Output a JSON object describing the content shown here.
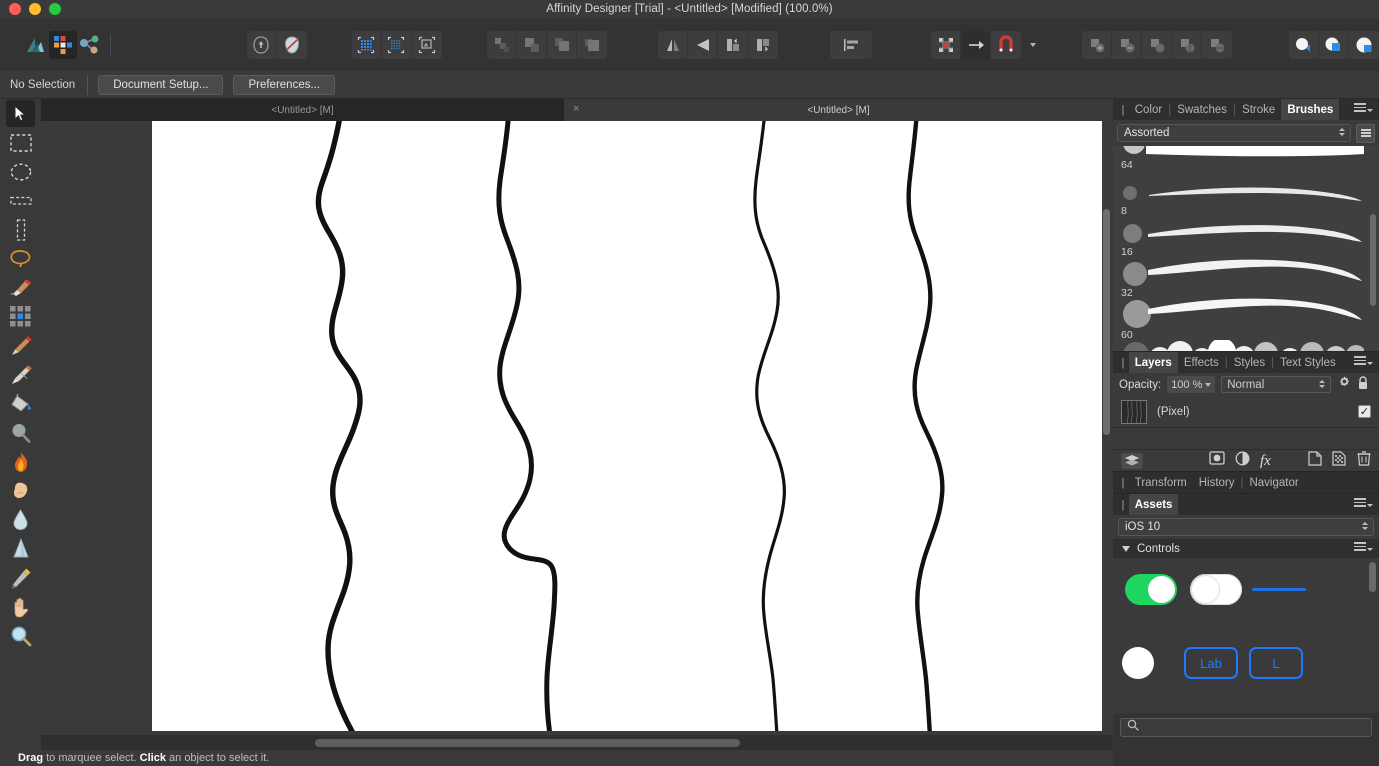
{
  "window": {
    "title": "Affinity Designer [Trial] - <Untitled> [Modified] (100.0%)",
    "traffic_lights": [
      "close",
      "minimize",
      "maximize"
    ]
  },
  "toolbar": {
    "personas": [
      {
        "name": "designer-persona",
        "label": "Designer Persona",
        "active": false
      },
      {
        "name": "pixel-persona",
        "label": "Pixel Persona",
        "active": true
      },
      {
        "name": "export-persona",
        "label": "Export Persona",
        "active": false
      }
    ],
    "groups": [
      {
        "name": "mask-group",
        "buttons": [
          "Add Mask",
          "Clear Mask"
        ]
      },
      {
        "name": "selection-group",
        "buttons": [
          "Refine Selection",
          "Invert Pixel Selection",
          "Selection From Layer"
        ]
      },
      {
        "name": "order-group",
        "buttons": [
          "Move to Front",
          "Move Forward",
          "Move Backward",
          "Move to Back"
        ]
      },
      {
        "name": "flip-group",
        "buttons": [
          "Flip Horizontal",
          "Flip Vertical",
          "Rotate Left",
          "Rotate Right"
        ]
      },
      {
        "name": "align-group",
        "buttons": [
          "Alignment"
        ]
      },
      {
        "name": "snap-group",
        "buttons": [
          "Show Grid",
          "Snapping",
          "Snapping Options"
        ]
      },
      {
        "name": "boolean-group",
        "buttons": [
          "Add",
          "Subtract",
          "Intersect",
          "Divide",
          "Combine"
        ]
      },
      {
        "name": "blend-group",
        "buttons": [
          "Blend Modes",
          "Blend Options",
          "Blend Ranges"
        ]
      }
    ]
  },
  "context_bar": {
    "selection_status": "No Selection",
    "document_setup_label": "Document Setup...",
    "preferences_label": "Preferences..."
  },
  "tools": [
    {
      "name": "move-tool",
      "label": "Move Tool",
      "icon": "cursor-arrow-icon",
      "selected": true
    },
    {
      "name": "rectangular-marquee-tool",
      "label": "Rectangular Marquee Tool",
      "icon": "rect-marquee-icon",
      "selected": false
    },
    {
      "name": "elliptical-marquee-tool",
      "label": "Elliptical Marquee Tool",
      "icon": "ellipse-marquee-icon",
      "selected": false
    },
    {
      "name": "row-marquee-tool",
      "label": "Row Marquee Tool",
      "icon": "row-marquee-icon",
      "selected": false
    },
    {
      "name": "column-marquee-tool",
      "label": "Column Marquee Tool",
      "icon": "column-marquee-icon",
      "selected": false
    },
    {
      "name": "freehand-selection-tool",
      "label": "Freehand Selection Tool",
      "icon": "lasso-icon",
      "selected": false
    },
    {
      "name": "selection-brush-tool",
      "label": "Selection Brush Tool",
      "icon": "selection-brush-icon",
      "selected": false
    },
    {
      "name": "flood-select-tool",
      "label": "Flood Select Tool",
      "icon": "pixel-grid-icon",
      "selected": false
    },
    {
      "name": "paint-brush-tool",
      "label": "Paint Brush Tool",
      "icon": "paintbrush-icon",
      "selected": false
    },
    {
      "name": "erase-brush-tool",
      "label": "Erase Brush Tool",
      "icon": "eraser-icon",
      "selected": false
    },
    {
      "name": "flood-fill-tool",
      "label": "Flood Fill Tool",
      "icon": "paint-bucket-icon",
      "selected": false
    },
    {
      "name": "blur-brush-tool",
      "label": "Blur Brush Tool",
      "icon": "blur-icon",
      "selected": false
    },
    {
      "name": "burn-brush-tool",
      "label": "Burn Brush Tool",
      "icon": "flame-icon",
      "selected": false
    },
    {
      "name": "dodge-brush-tool",
      "label": "Dodge Brush Tool",
      "icon": "hand-dodge-icon",
      "selected": false
    },
    {
      "name": "smudge-brush-tool",
      "label": "Smudge Brush Tool",
      "icon": "water-drop-icon",
      "selected": false
    },
    {
      "name": "sponge-brush-tool",
      "label": "Sponge Brush Tool",
      "icon": "cone-icon",
      "selected": false
    },
    {
      "name": "colour-picker-tool",
      "label": "Colour Picker Tool",
      "icon": "eyedropper-icon",
      "selected": false
    },
    {
      "name": "view-tool",
      "label": "View Tool",
      "icon": "hand-icon",
      "selected": false
    },
    {
      "name": "zoom-tool",
      "label": "Zoom Tool",
      "icon": "magnifier-icon",
      "selected": false
    }
  ],
  "document_tabs": [
    {
      "label": "<Untitled> [M]",
      "active": false,
      "closable": false
    },
    {
      "label": "<Untitled> [M]",
      "active": true,
      "closable": true,
      "close_glyph": "×"
    }
  ],
  "canvas": {
    "zoom_level": "100.0%",
    "background": "#ffffff",
    "artwork_description": "four hand-drawn wavy vertical black brush strokes"
  },
  "statusbar": {
    "hint_bold_1": "Drag",
    "hint_mid_1": " to marquee select. ",
    "hint_bold_2": "Click",
    "hint_mid_2": " an object to select it."
  },
  "brushes_panel": {
    "tabs": [
      {
        "label": "Color",
        "active": false
      },
      {
        "label": "Swatches",
        "active": false
      },
      {
        "label": "Stroke",
        "active": false
      },
      {
        "label": "Brushes",
        "active": true
      }
    ],
    "category": "Assorted",
    "brushes": [
      {
        "size": "64"
      },
      {
        "size": "8"
      },
      {
        "size": "16"
      },
      {
        "size": "32"
      },
      {
        "size": "60"
      }
    ]
  },
  "layers_panel": {
    "tabs": [
      {
        "label": "Layers",
        "active": true
      },
      {
        "label": "Effects",
        "active": false
      },
      {
        "label": "Styles",
        "active": false
      },
      {
        "label": "Text Styles",
        "active": false
      }
    ],
    "opacity_label": "Opacity:",
    "opacity_value": "100 %",
    "blend_mode": "Normal",
    "layers": [
      {
        "name": "(Pixel)",
        "visible": true,
        "check_glyph": "✓"
      }
    ],
    "bottom_buttons": [
      {
        "name": "layer-stack-button",
        "label": "Layers"
      },
      {
        "name": "mask-layer-button",
        "label": "Mask Layer"
      },
      {
        "name": "adjustment-layer-button",
        "label": "Adjustment"
      },
      {
        "name": "layer-effects-button",
        "label": "fx"
      },
      {
        "name": "add-pixel-layer-button",
        "label": "Add Pixel Layer"
      },
      {
        "name": "add-mask-button",
        "label": "Add Mask"
      },
      {
        "name": "delete-layer-button",
        "label": "Delete"
      }
    ]
  },
  "transform_panel": {
    "tabs": [
      {
        "label": "Transform",
        "active": false
      },
      {
        "label": "History",
        "active": false
      },
      {
        "label": "Navigator",
        "active": false
      }
    ]
  },
  "assets_panel": {
    "tabs": [
      {
        "label": "Assets",
        "active": true
      }
    ],
    "library": "iOS 10",
    "group": "Controls",
    "items": [
      {
        "name": "toggle-on-asset",
        "type": "toggle",
        "state": "on",
        "color": "#1ed660"
      },
      {
        "name": "toggle-off-asset",
        "type": "toggle",
        "state": "off",
        "color": "#ffffff"
      },
      {
        "name": "slider-line-asset",
        "type": "line",
        "color": "#1f6fe5"
      },
      {
        "name": "circle-asset",
        "type": "circle",
        "color": "#ffffff"
      },
      {
        "name": "label-button-asset",
        "type": "button",
        "label": "Lab",
        "color": "#1f78ff"
      },
      {
        "name": "label-button-asset-2",
        "type": "button",
        "label": "L",
        "color": "#1f78ff"
      }
    ],
    "search_placeholder": ""
  },
  "colors": {
    "window_chrome": "#333333",
    "panel_bg": "#3a3a3a",
    "canvas_bg": "#3a3a3a",
    "accent_blue": "#2e8ae6",
    "accent_green": "#1ed660",
    "snap_red": "#d03a3a"
  }
}
